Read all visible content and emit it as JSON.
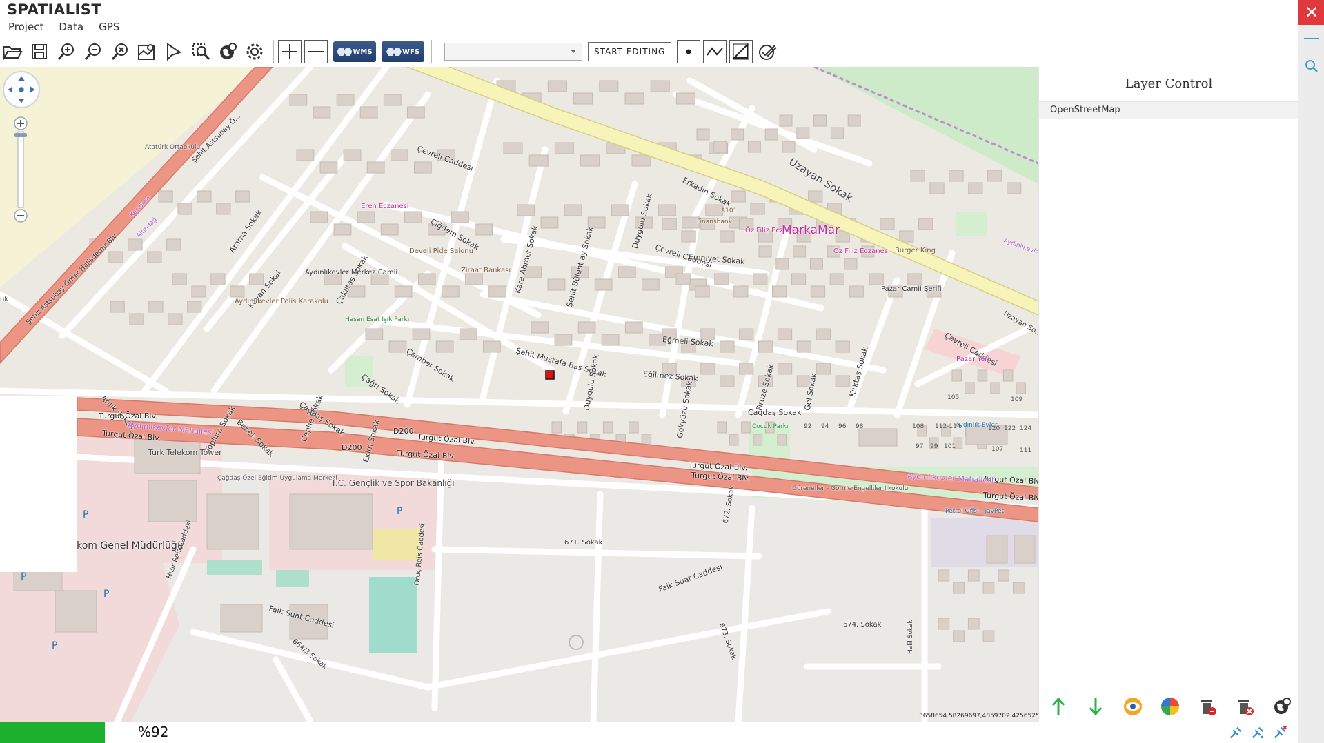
{
  "app": {
    "title": "SPATIALIST"
  },
  "menu": {
    "items": [
      "Project",
      "Data",
      "GPS"
    ]
  },
  "toolbar": {
    "wms_label": "WMS",
    "wfs_label": "WFS",
    "layer_select_value": "",
    "start_editing_label": "START EDITING",
    "icons": [
      "folder-open-icon",
      "save-icon",
      "zoom-in-icon",
      "zoom-out-icon",
      "zoom-extent-icon",
      "map-pin-icon",
      "select-arrow-icon",
      "search-map-icon",
      "globe-icon",
      "gear-icon",
      "plus-icon",
      "minus-icon"
    ]
  },
  "layer_control": {
    "title": "Layer Control",
    "layers": [
      "OpenStreetMap"
    ]
  },
  "map": {
    "coordinates_readout": "3658654.58269697,4859702.42565258",
    "labels": {
      "cevreli_caddesi_1": "Çevreli Caddesi",
      "cevreli_caddesi_2": "Çevreli Caddesi",
      "cevreli_caddesi_3": "Çevreli Caddesi",
      "uzayan_sokak": "Uzayan Sokak",
      "uzayan_so": "Uzayan So...",
      "erkadin_sokak": "Erkadın Sokak",
      "cigdem_sokak": "Çiğdem Sokak",
      "cakiltas_sokak": "Çakıltaş Sokak",
      "kovan_sokak": "Kovan Sokak",
      "arama_sokak": "Arama Sokak",
      "cember_sokak": "Çember Sokak",
      "cagri_sokak": "Çağrı Sokak",
      "cagdas_sokak_1": "Çağdaş Sokak",
      "cagdas_sokak_2": "Çağdaş Sokak",
      "sehit_mustafa_bas": "Şehit Mustafa Baş Sokak",
      "kara_ahmet": "Kara Ahmet Sokak",
      "sehit_bulent": "Şehit Bülent ay Sokak",
      "duygulu_sokak_1": "Duygulu Sokak",
      "duygulu_sokak_2": "Duygulu Sokak",
      "emniyet_sokak": "Emniyet Sokak",
      "egmeli_sokak": "Eğmeli Sokak",
      "egilmez_sokak": "Eğilmez Sokak",
      "gokyuzu_sokak": "Gökyüzü Sokak",
      "firuze_sokak": "Firuze Sokak",
      "gel_sokak": "Gel Sokak",
      "kirktas_sokak": "Kırktaş Sokak",
      "arilik_sokak": "Arılık Sokak",
      "bebek_sokak": "Bebek Sokak",
      "toplum_sokak": "Toplum Sokak",
      "cephe_sokak": "Cephe Sokak",
      "ekim_sokak": "Ekim Sokak",
      "turgut_ozal_1": "Turgut Özal Blv.",
      "turgut_ozal_2": "Turgut Özal Blv.",
      "turgut_ozal_3": "Turgut Özal Blv.",
      "turgut_ozal_4": "Turgut Özal Blv.",
      "turgut_ozal_5": "Turgut Özal Blv.",
      "turgut_ozal_6": "Turgut Özal Blv.",
      "turgut_ozal_7": "Turgut Özal Blv.",
      "turgut_ozal_8": "Turgut Özal Blv.",
      "d200_1": "D200",
      "d200_2": "D200",
      "aydinlikevler_mah_1": "Aydınlıkevler Mahallesi",
      "aydinlikevler_mah_2": "Aydınlıkevler Mahallesi",
      "aydinlikevler_mah_3": "Aydınlıkevler Mahallesi",
      "sehit_astsubay_1": "Şehit Astsubay Ö...",
      "sehit_astsubay_2": "Şehit Astsubay Ömer Halisdemir Blv.",
      "kecioren": "Keçiören",
      "altindag": "Altındağ",
      "ataturk_okulu": "Atatürk Ortaokulu",
      "eren_eczanesi": "Eren Eczanesi",
      "develi_pide": "Develi Pide Salonu",
      "ziraat_bankasi": "Ziraat Bankası",
      "aydinlikevler_cami": "Aydınlıkevler Merkez Camii",
      "polis_karakolu": "Aydınlıkevler Polis Karakolu",
      "hasan_esat_parki": "Hasan Esat Işık Parkı",
      "a101": "A101",
      "finansbank": "Finansbank",
      "oz_filiz_1": "Öz Filiz Eczanesi",
      "oz_filiz_2": "Öz Filiz Eczanesi",
      "markamar": "MarkaMar",
      "burger_king": "Burger King",
      "pazar_camii": "Pazar Camii Şerifi",
      "pazar_yeri": "Pazar Yeri",
      "cocuk_parki": "Çocuk Parkı",
      "aydinlik_evler": "Aydınlık Evler",
      "turk_telekom_tower": "Turk Telekom Tower",
      "cagdas_ozel": "Çağdaş Özel Eğitim Uygulama Merkezi",
      "genclik_spor": "T.C. Gençlik ve Spor Bakanlığı",
      "turk_telekom_genel": "Türk Telekom Genel Müdürlüğü",
      "hizir_reis": "Hızır Reis Caddesi",
      "oruc_reis": "Oruç Reis Caddesi",
      "sokak_671": "671. Sokak",
      "sokak_672": "672. Sokak",
      "sokak_673": "673. Sokak",
      "sokak_674": "674. Sokak",
      "sokak_664_3": "664/3 Sokak",
      "faik_suat_caddesi_1": "Faik Suat Caddesi",
      "faik_suat_caddesi_2": "Faik Suat Caddesi",
      "goreneller": "Göreneller - Görme Engelliler İlkokulu",
      "petrol_ofisi": "Petrol Ofisi - JavPet",
      "parking": "P",
      "halil_sokak": "Halil Sokak",
      "num_92": "92",
      "num_94": "94",
      "num_96": "96",
      "num_98": "98",
      "num_108": "108",
      "num_112": "112-114",
      "num_120": "120",
      "num_122": "122",
      "num_124": "124",
      "num_97": "97",
      "num_99": "99",
      "num_101": "101",
      "num_105": "105",
      "num_109": "109",
      "num_107": "107",
      "num_111": "111",
      "uk": "uk"
    }
  },
  "status": {
    "progress_label": "%92",
    "progress_value": 0.092
  },
  "colors": {
    "accent": "#1db02e",
    "close": "#e0383f",
    "motorway": "#ec9585",
    "primary": "#f7f4b9",
    "park": "#c7e8c5",
    "building": "#d9d0c9"
  }
}
